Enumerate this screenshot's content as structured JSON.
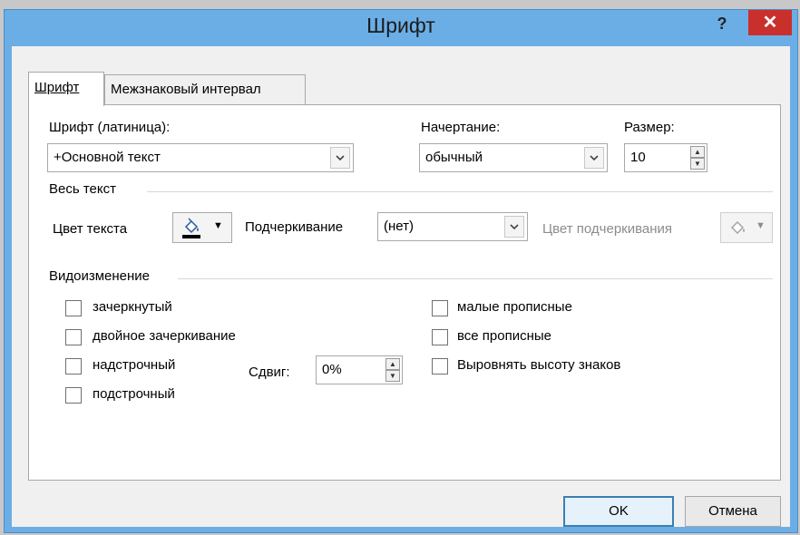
{
  "window": {
    "title": "Шрифт",
    "help_label": "?",
    "close_label": "✕"
  },
  "tabs": [
    {
      "label": "Шрифт"
    },
    {
      "label": "Межзнаковый интервал"
    }
  ],
  "font": {
    "latin_label": "Шрифт (латиница):",
    "latin_value": "+Основной текст",
    "style_label": "Начертание:",
    "style_value": "обычный",
    "size_label": "Размер:",
    "size_value": "10"
  },
  "all_text": {
    "section_label": "Весь текст",
    "color_label": "Цвет текста",
    "underline_label": "Подчеркивание",
    "underline_value": "(нет)",
    "underline_color_label": "Цвет подчеркивания"
  },
  "effects": {
    "section_label": "Видоизменение",
    "strikethrough": "зачеркнутый",
    "double_strikethrough": "двойное зачеркивание",
    "superscript": "надстрочный",
    "subscript": "подстрочный",
    "offset_label": "Сдвиг:",
    "offset_value": "0%",
    "small_caps": "малые прописные",
    "all_caps": "все прописные",
    "equalize_height": "Выровнять высоту знаков"
  },
  "buttons": {
    "ok": "OK",
    "cancel": "Отмена"
  },
  "colors": {
    "accent": "#3c7fb1",
    "title_bar": "#6baee6",
    "close": "#c9302c"
  },
  "icons": {
    "dropdown": "chevron-down-icon",
    "font_color": "paint-bucket-icon",
    "spin": "spin-arrows-icon"
  }
}
